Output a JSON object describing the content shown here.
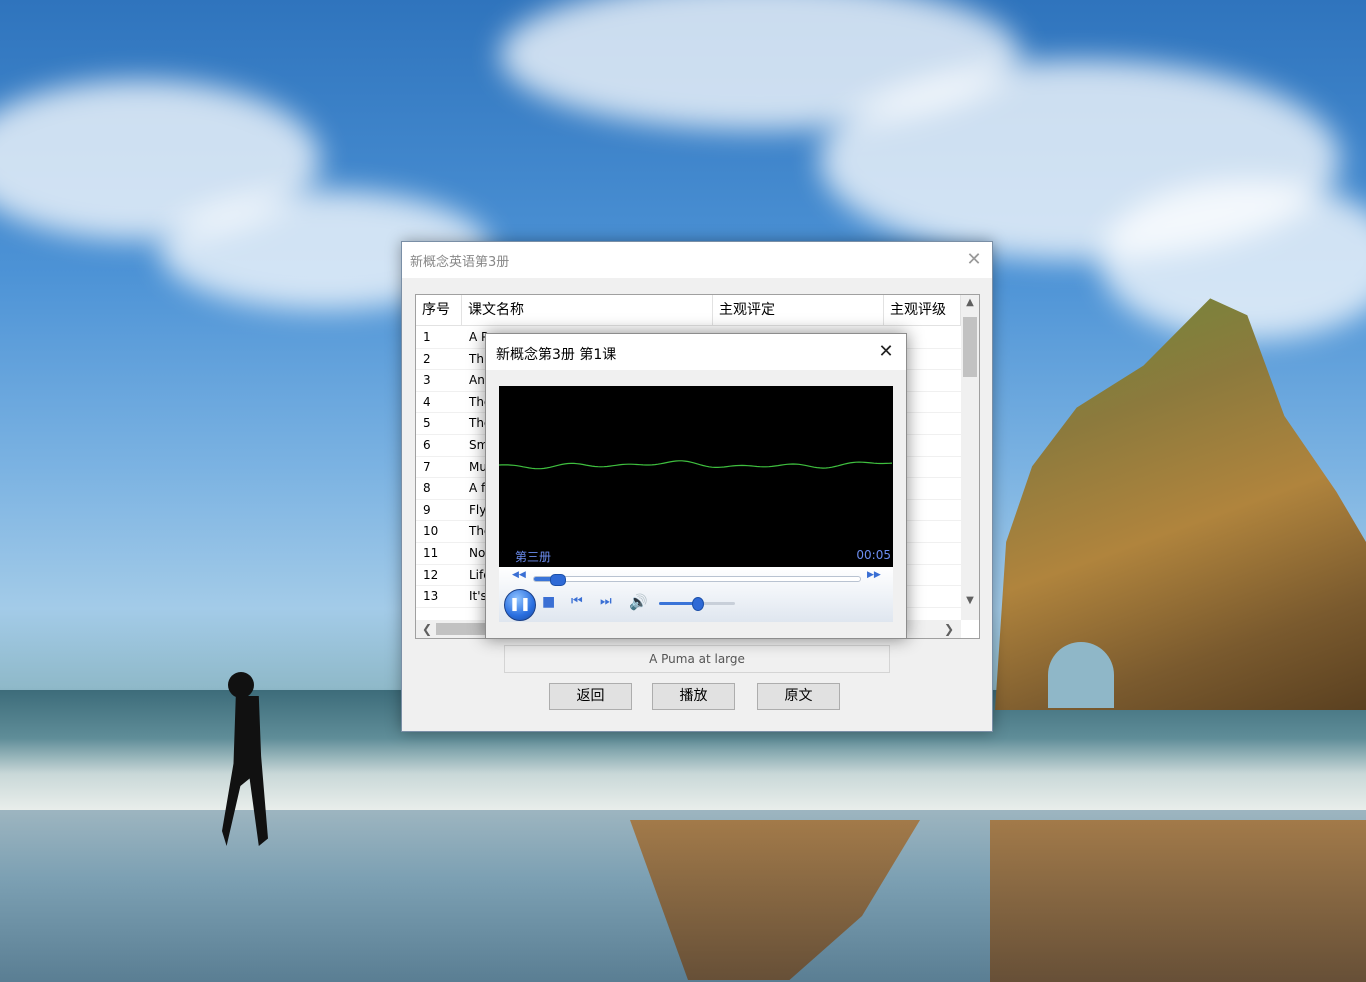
{
  "main_window": {
    "title": "新概念英语第3册",
    "close_glyph": "✕",
    "columns": [
      "序号",
      "课文名称",
      "主观评定",
      "主观评级"
    ],
    "rows": [
      {
        "num": "1",
        "title": "A P"
      },
      {
        "num": "2",
        "title": "Thi"
      },
      {
        "num": "3",
        "title": "An"
      },
      {
        "num": "4",
        "title": "The"
      },
      {
        "num": "5",
        "title": "The"
      },
      {
        "num": "6",
        "title": "Sm"
      },
      {
        "num": "7",
        "title": "Mu"
      },
      {
        "num": "8",
        "title": "A f"
      },
      {
        "num": "9",
        "title": "Flyi"
      },
      {
        "num": "10",
        "title": "The"
      },
      {
        "num": "11",
        "title": "Not"
      },
      {
        "num": "12",
        "title": "Life"
      },
      {
        "num": "13",
        "title": "It's"
      }
    ],
    "selected_lesson": "A Puma at large",
    "buttons": {
      "back": "返回",
      "play": "播放",
      "text": "原文"
    },
    "icons": {
      "up": "up-arrow-icon",
      "down": "down-arrow-icon",
      "left": "left-arrow-icon",
      "right": "right-arrow-icon"
    }
  },
  "player_window": {
    "title": "新概念第3册 第1课",
    "close_glyph": "✕",
    "album": "第三册",
    "time": "00:05",
    "seek_progress": 0.06,
    "volume": 0.5,
    "wave_color": "#3fbf3f",
    "accent_color": "#3a74d8"
  }
}
